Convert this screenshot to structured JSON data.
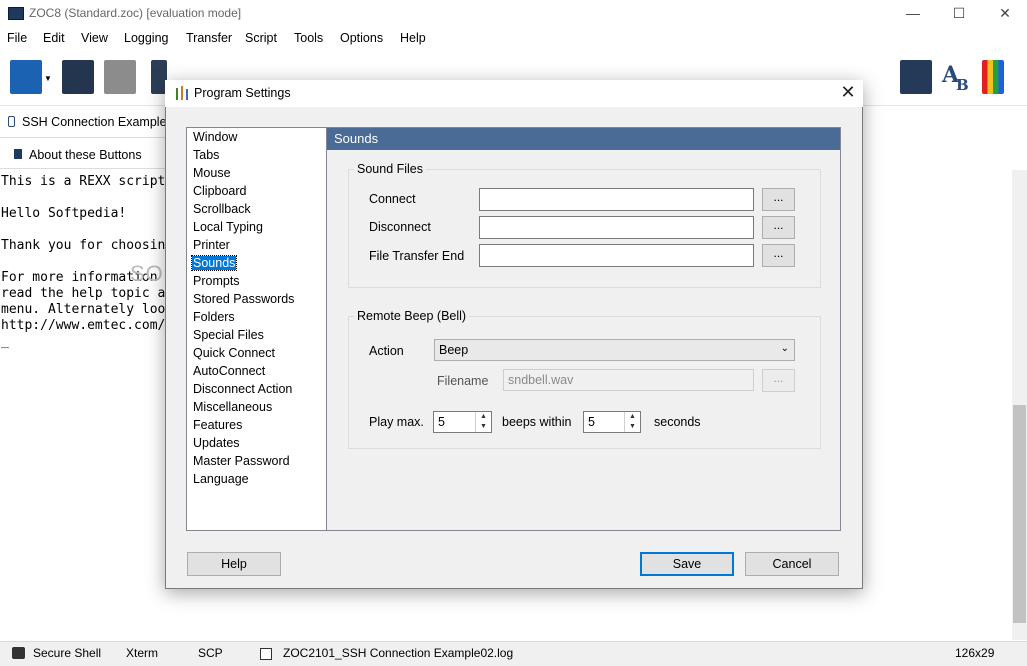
{
  "window": {
    "title": "ZOC8 (Standard.zoc) [evaluation mode]",
    "minimize": "—",
    "maximize": "☐",
    "close": "✕"
  },
  "menu": [
    "File",
    "Edit",
    "View",
    "Logging",
    "Transfer",
    "Script",
    "Tools",
    "Options",
    "Help"
  ],
  "session_tab": {
    "label": "SSH Connection Example"
  },
  "buttonbar": {
    "label": "About these Buttons"
  },
  "terminal": {
    "lines": [
      "This is a REXX script",
      "",
      "Hello Softpedia!",
      "",
      "Thank you for choosing",
      "",
      "For more information",
      "read the help topic a",
      "menu. Alternately loo",
      "http://www.emtec.com/",
      "_"
    ],
    "watermark": "SOFTPEDIA"
  },
  "statusbar": {
    "connection": "Secure Shell",
    "emulation": "Xterm",
    "transfer": "SCP",
    "logfile": "ZOC2101_SSH Connection Example02.log",
    "size": "126x29"
  },
  "dialog": {
    "title": "Program Settings",
    "close": "✕",
    "nav": [
      "Window",
      "Tabs",
      "Mouse",
      "Clipboard",
      "Scrollback",
      "Local Typing",
      "Printer",
      "Sounds",
      "Prompts",
      "Stored Passwords",
      "Folders",
      "Special Files",
      "Quick Connect",
      "AutoConnect",
      "Disconnect Action",
      "Miscellaneous",
      "Features",
      "Updates",
      "Master Password",
      "Language"
    ],
    "selected": "Sounds",
    "panel_title": "Sounds",
    "sound_files": {
      "group_label": "Sound Files",
      "connect_label": "Connect",
      "connect_value": "",
      "disconnect_label": "Disconnect",
      "disconnect_value": "",
      "transfer_end_label": "File Transfer End",
      "transfer_end_value": "",
      "browse": "..."
    },
    "remote_beep": {
      "group_label": "Remote Beep (Bell)",
      "action_label": "Action",
      "action_value": "Beep",
      "filename_label": "Filename",
      "filename_value": "sndbell.wav",
      "browse": "...",
      "play_max_label": "Play max.",
      "play_max_value": "5",
      "beeps_within_label": "beeps within",
      "seconds_value": "5",
      "seconds_label": "seconds"
    },
    "buttons": {
      "help": "Help",
      "save": "Save",
      "cancel": "Cancel"
    }
  },
  "colors": {
    "panel_header": "#496b96",
    "selection": "#0078d7"
  }
}
